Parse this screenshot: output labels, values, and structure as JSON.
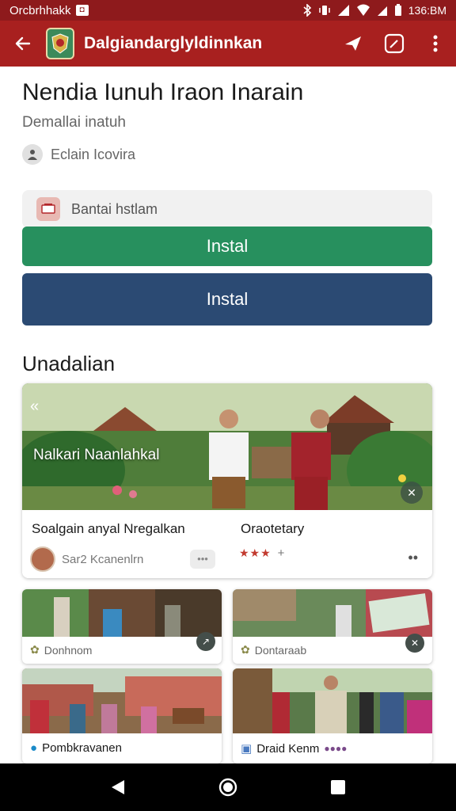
{
  "status_bar": {
    "carrier": "Orcbrhhakk",
    "time": "136:BM"
  },
  "app_bar": {
    "title": "Dalgiandarglyldinnkan"
  },
  "app": {
    "name": "Nendia Iunuh Iraon Inarain",
    "subtitle": "Demallai inatuh",
    "developer": "Eclain Icovira"
  },
  "info_box": {
    "text": "Bantai hstlam"
  },
  "buttons": {
    "install_primary": "Instal",
    "install_secondary": "Instal"
  },
  "section": {
    "title": "Unadalian"
  },
  "hero": {
    "caption": "Nalkari Naanlahkal",
    "card_left": {
      "title": "Soalgain anyal Nregalkan",
      "author": "Sar2 Kcanenlrn"
    },
    "card_right": {
      "title": "Oraotetary",
      "stars": "★★★",
      "extra": "+"
    }
  },
  "tiles": [
    {
      "label": "Donhnom"
    },
    {
      "label": "Dontaraab"
    },
    {
      "label": "Pombkravanen"
    },
    {
      "label": "Draid Kenm"
    }
  ],
  "colors": {
    "status_bar": "#8e1a1c",
    "app_bar": "#a8201f",
    "install_green": "#27905e",
    "install_blue": "#2b4a73"
  }
}
